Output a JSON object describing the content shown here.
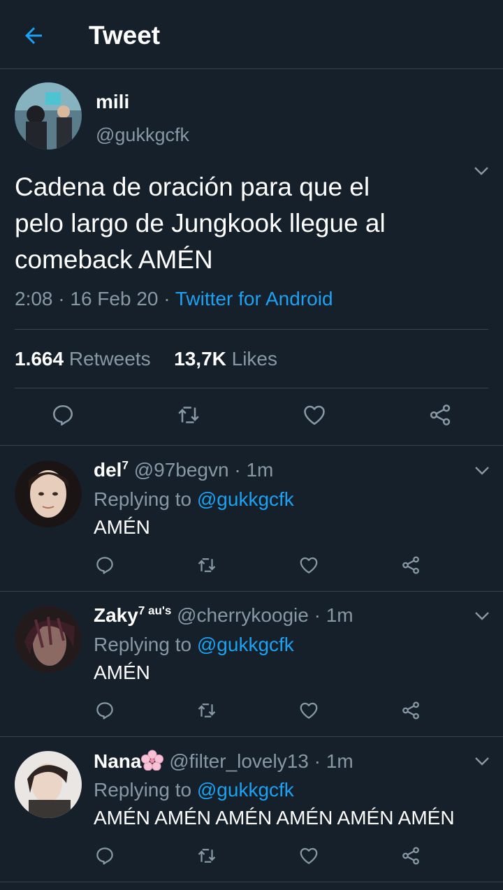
{
  "header": {
    "title": "Tweet",
    "back_icon": "arrow-left-icon"
  },
  "main_tweet": {
    "name": "mili",
    "handle": "@gukkgcfk",
    "text_lines": [
      "Cadena de oración para que el",
      "pelo largo de Jungkook llegue al",
      "comeback AMÉN"
    ],
    "time": "2:08 · 16 Feb 20 · ",
    "source": "Twitter for Android",
    "retweets_count": "1.664",
    "retweets_label": " Retweets",
    "likes_count": "13,7K",
    "likes_label": " Likes"
  },
  "replies": [
    {
      "name": "del",
      "name_sup": "7",
      "handle": "@97begvn · 1m",
      "replying_prefix": "Replying to ",
      "replying_mention": "@gukkgcfk",
      "text": "AMÉN"
    },
    {
      "name": "Zaky",
      "name_sup": "7 au's",
      "handle": "@cherrykoogie · 1m",
      "replying_prefix": "Replying to ",
      "replying_mention": "@gukkgcfk",
      "text": "AMÉN"
    },
    {
      "name": "Nana",
      "name_emoji": "cherry-blossom-icon",
      "handle": "@filter_lovely13 · 1m",
      "replying_prefix": "Replying to ",
      "replying_mention": "@gukkgcfk",
      "text": "AMÉN AMÉN AMÉN AMÉN AMÉN AMÉN"
    }
  ],
  "action_icons": [
    "reply-icon",
    "retweet-icon",
    "like-icon",
    "share-icon"
  ],
  "colors": {
    "background": "#15202b",
    "divider": "#38444d",
    "secondary_text": "#8899a6",
    "accent": "#1da1f2"
  }
}
